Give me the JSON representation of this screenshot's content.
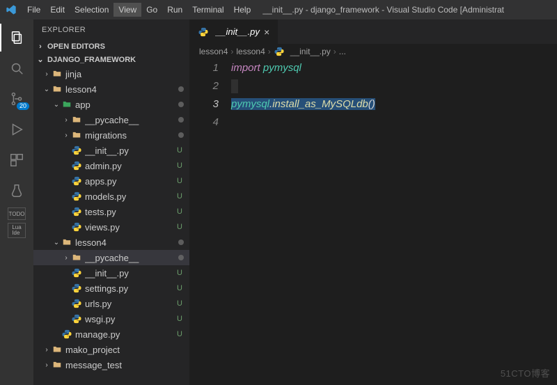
{
  "titlebar": {
    "menu": [
      "File",
      "Edit",
      "Selection",
      "View",
      "Go",
      "Run",
      "Terminal",
      "Help"
    ],
    "active_menu_index": 3,
    "window_title": "__init__.py - django_framework - Visual Studio Code [Administrat"
  },
  "activity": {
    "badge_source_control": "20",
    "labels": [
      "Explorer",
      "Search",
      "Source Control",
      "Run",
      "Extensions",
      "Testing",
      "TODO",
      "Lua IDE"
    ]
  },
  "sidebar": {
    "title": "EXPLORER",
    "sections": {
      "open_editors": "OPEN EDITORS",
      "project": "DJANGO_FRAMEWORK"
    },
    "tree": [
      {
        "depth": 0,
        "kind": "folder",
        "name": "jinja",
        "expanded": false,
        "status": ""
      },
      {
        "depth": 0,
        "kind": "folder",
        "name": "lesson4",
        "expanded": true,
        "status": "dot"
      },
      {
        "depth": 1,
        "kind": "folder-app",
        "name": "app",
        "expanded": true,
        "status": "dot"
      },
      {
        "depth": 2,
        "kind": "folder",
        "name": "__pycache__",
        "expanded": false,
        "status": "dot"
      },
      {
        "depth": 2,
        "kind": "folder",
        "name": "migrations",
        "expanded": false,
        "status": "dot"
      },
      {
        "depth": 2,
        "kind": "py",
        "name": "__init__.py",
        "status": "U"
      },
      {
        "depth": 2,
        "kind": "py",
        "name": "admin.py",
        "status": "U"
      },
      {
        "depth": 2,
        "kind": "py",
        "name": "apps.py",
        "status": "U"
      },
      {
        "depth": 2,
        "kind": "py",
        "name": "models.py",
        "status": "U"
      },
      {
        "depth": 2,
        "kind": "py",
        "name": "tests.py",
        "status": "U"
      },
      {
        "depth": 2,
        "kind": "py",
        "name": "views.py",
        "status": "U"
      },
      {
        "depth": 1,
        "kind": "folder",
        "name": "lesson4",
        "expanded": true,
        "status": "dot"
      },
      {
        "depth": 2,
        "kind": "folder",
        "name": "__pycache__",
        "expanded": false,
        "status": "dot",
        "selected": true
      },
      {
        "depth": 2,
        "kind": "py",
        "name": "__init__.py",
        "status": "U"
      },
      {
        "depth": 2,
        "kind": "py",
        "name": "settings.py",
        "status": "U"
      },
      {
        "depth": 2,
        "kind": "py",
        "name": "urls.py",
        "status": "U"
      },
      {
        "depth": 2,
        "kind": "py",
        "name": "wsgi.py",
        "status": "U"
      },
      {
        "depth": 1,
        "kind": "py",
        "name": "manage.py",
        "status": "U"
      },
      {
        "depth": 0,
        "kind": "folder",
        "name": "mako_project",
        "expanded": false,
        "status": ""
      },
      {
        "depth": 0,
        "kind": "folder",
        "name": "message_test",
        "expanded": false,
        "status": ""
      }
    ]
  },
  "tabs": {
    "open": [
      {
        "label": "__init__.py"
      }
    ]
  },
  "breadcrumbs": [
    "lesson4",
    "lesson4",
    "__init__.py",
    "..."
  ],
  "code": {
    "lines": [
      {
        "n": 1,
        "html": "<span class='kw'>import</span> <span class='mod'>pymysql</span>"
      },
      {
        "n": 2,
        "html": "<span class='afterline'></span>"
      },
      {
        "n": 3,
        "html": "<span class='sel-bg'><span class='mod'>pymysql</span><span class='punc'>.</span><span class='fn'>install_as_MySQLdb</span><span class='punc'>()</span></span>"
      },
      {
        "n": 4,
        "html": ""
      }
    ],
    "current_line": 3
  },
  "watermark": "51CTO博客"
}
